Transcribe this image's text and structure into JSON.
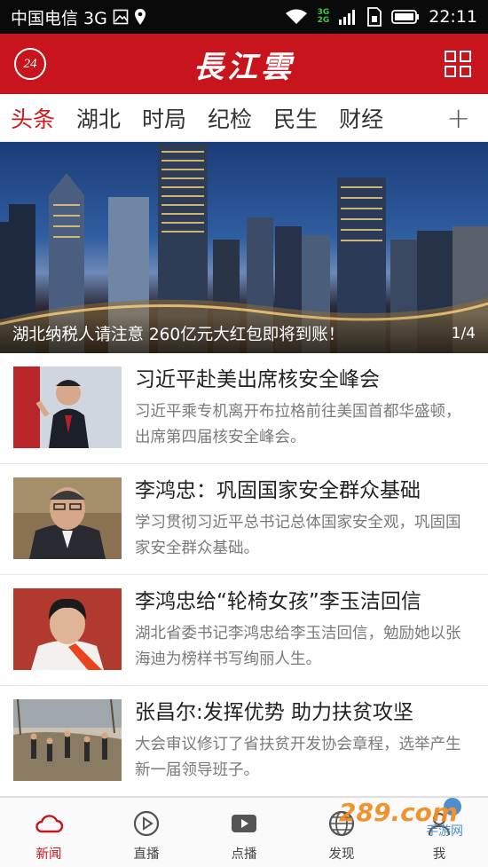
{
  "status_bar": {
    "carrier": "中国电信 3G",
    "net_top": "3G",
    "net_bottom": "2G",
    "time": "22:11"
  },
  "header": {
    "weather_badge": "24",
    "app_name": "長江雲"
  },
  "tabs": [
    {
      "label": "头条",
      "active": true
    },
    {
      "label": "湖北"
    },
    {
      "label": "时局"
    },
    {
      "label": "纪检"
    },
    {
      "label": "民生"
    },
    {
      "label": "财经"
    }
  ],
  "tab_add": "+",
  "banner": {
    "title": "湖北纳税人请注意 260亿元大红包即将到账！",
    "page": "1/4"
  },
  "news": [
    {
      "title": "习近平赴美出席核安全峰会",
      "summary": "习近平乘专机离开布拉格前往美国首都华盛顿，出席第四届核安全峰会。"
    },
    {
      "title": "李鸿忠：巩固国家安全群众基础",
      "summary": "学习贯彻习近平总书记总体国家安全观，巩固国家安全群众基础。"
    },
    {
      "title": "李鸿忠给“轮椅女孩”李玉洁回信",
      "summary": "湖北省委书记李鸿忠给李玉洁回信，勉励她以张海迪为榜样书写绚丽人生。"
    },
    {
      "title": "张昌尔:发挥优势 助力扶贫攻坚",
      "summary": "大会审议修订了省扶贫开发协会章程，选举产生新一届领导班子。"
    }
  ],
  "bottom_nav": [
    {
      "label": "新闻",
      "icon": "cloud-icon",
      "active": true
    },
    {
      "label": "直播",
      "icon": "play-circle-icon"
    },
    {
      "label": "点播",
      "icon": "video-icon"
    },
    {
      "label": "发现",
      "icon": "globe-icon"
    },
    {
      "label": "我",
      "icon": "user-icon"
    }
  ],
  "watermark": {
    "text": "289.com",
    "sub": "手游网"
  },
  "colors": {
    "brand_red": "#c8151d",
    "tab_active": "#d0161f",
    "status_bg": "#0a0a0a"
  }
}
